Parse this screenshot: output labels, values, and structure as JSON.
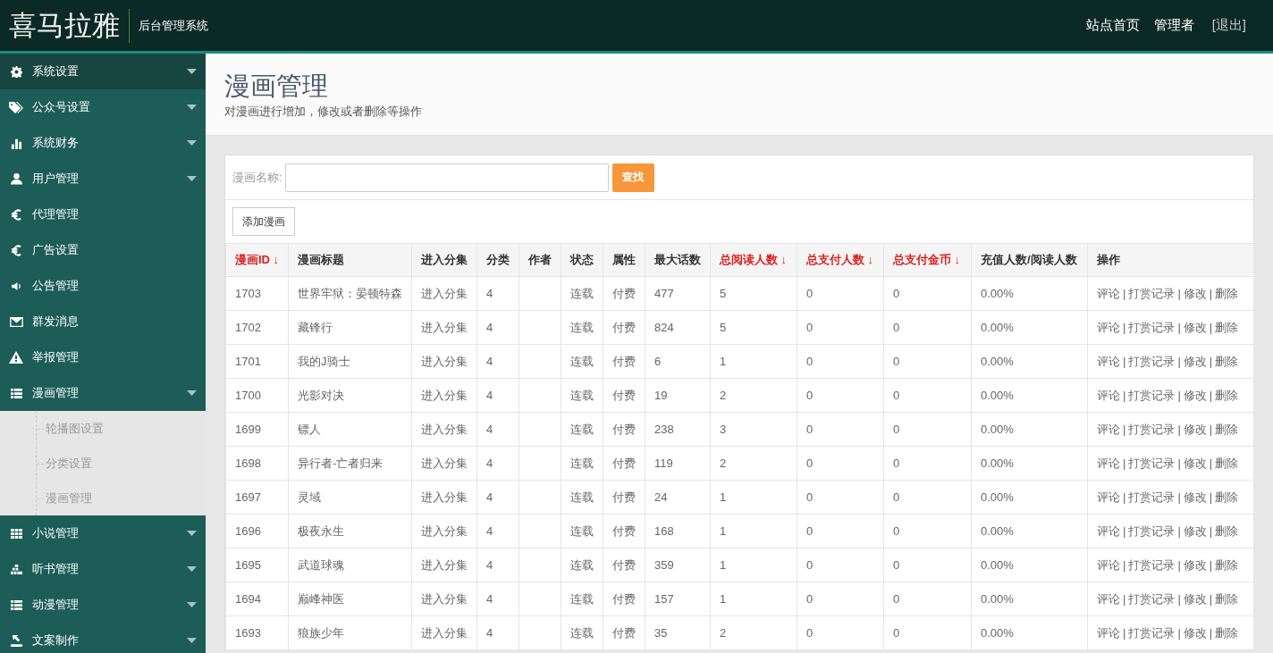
{
  "header": {
    "logo": "喜马拉雅",
    "subtitle": "后台管理系统",
    "links": [
      "站点首页",
      "管理者",
      "[退出]"
    ]
  },
  "sidebar": {
    "items": [
      {
        "label": "系统设置",
        "selected": true,
        "has_submenu": true
      },
      {
        "label": "公众号设置",
        "selected": false,
        "has_submenu": true
      },
      {
        "label": "系统财务",
        "selected": false,
        "has_submenu": true
      },
      {
        "label": "用户管理",
        "selected": false,
        "has_submenu": true
      },
      {
        "label": "代理管理",
        "selected": false,
        "has_submenu": false
      },
      {
        "label": "广告设置",
        "selected": false,
        "has_submenu": false
      },
      {
        "label": "公告管理",
        "selected": false,
        "has_submenu": false
      },
      {
        "label": "群发消息",
        "selected": false,
        "has_submenu": false
      },
      {
        "label": "举报管理",
        "selected": false,
        "has_submenu": false
      },
      {
        "label": "漫画管理",
        "selected": false,
        "has_submenu": true,
        "expanded": true,
        "children": [
          {
            "label": "轮播图设置"
          },
          {
            "label": "分类设置"
          },
          {
            "label": "漫画管理"
          }
        ]
      },
      {
        "label": "小说管理",
        "selected": false,
        "has_submenu": true
      },
      {
        "label": "听书管理",
        "selected": false,
        "has_submenu": true
      },
      {
        "label": "动漫管理",
        "selected": false,
        "has_submenu": true
      },
      {
        "label": "文案制作",
        "selected": false,
        "has_submenu": true
      }
    ]
  },
  "page": {
    "title": "漫画管理",
    "description": "对漫画进行增加，修改或者删除等操作"
  },
  "search": {
    "label": "漫画名称:",
    "button": "查找"
  },
  "add_button": "添加漫画",
  "table": {
    "action_separator": "|",
    "columns": [
      {
        "label": "漫画ID ↓",
        "sortable": true
      },
      {
        "label": "漫画标题",
        "sortable": false
      },
      {
        "label": "进入分集",
        "sortable": false
      },
      {
        "label": "分类",
        "sortable": false
      },
      {
        "label": "作者",
        "sortable": false
      },
      {
        "label": "状态",
        "sortable": false
      },
      {
        "label": "属性",
        "sortable": false
      },
      {
        "label": "最大话数",
        "sortable": false
      },
      {
        "label": "总阅读人数 ↓",
        "sortable": true
      },
      {
        "label": "总支付人数 ↓",
        "sortable": true
      },
      {
        "label": "总支付金币 ↓",
        "sortable": true
      },
      {
        "label": "充值人数/阅读人数",
        "sortable": false
      },
      {
        "label": "操作",
        "sortable": false
      }
    ],
    "rows": [
      {
        "id": "1703",
        "title": "世界牢狱：晏顿特森",
        "episodes": "进入分集",
        "category": "4",
        "status": "连载",
        "attribute": "付费",
        "max_chapters": "477",
        "readers": "5",
        "payers": "0",
        "coins": "0",
        "ratio": "0.00%",
        "actions": [
          "评论",
          "打赏记录",
          "修改",
          "删除"
        ]
      },
      {
        "id": "1702",
        "title": "藏锋行",
        "episodes": "进入分集",
        "category": "4",
        "status": "连载",
        "attribute": "付费",
        "max_chapters": "824",
        "readers": "5",
        "payers": "0",
        "coins": "0",
        "ratio": "0.00%",
        "actions": [
          "评论",
          "打赏记录",
          "修改",
          "删除"
        ]
      },
      {
        "id": "1701",
        "title": "我的J骑士",
        "episodes": "进入分集",
        "category": "4",
        "status": "连载",
        "attribute": "付费",
        "max_chapters": "6",
        "readers": "1",
        "payers": "0",
        "coins": "0",
        "ratio": "0.00%",
        "actions": [
          "评论",
          "打赏记录",
          "修改",
          "删除"
        ]
      },
      {
        "id": "1700",
        "title": "光影对决",
        "episodes": "进入分集",
        "category": "4",
        "status": "连载",
        "attribute": "付费",
        "max_chapters": "19",
        "readers": "2",
        "payers": "0",
        "coins": "0",
        "ratio": "0.00%",
        "actions": [
          "评论",
          "打赏记录",
          "修改",
          "删除"
        ]
      },
      {
        "id": "1699",
        "title": "镖人",
        "episodes": "进入分集",
        "category": "4",
        "status": "连载",
        "attribute": "付费",
        "max_chapters": "238",
        "readers": "3",
        "payers": "0",
        "coins": "0",
        "ratio": "0.00%",
        "actions": [
          "评论",
          "打赏记录",
          "修改",
          "删除"
        ]
      },
      {
        "id": "1698",
        "title": "异行者-亡者归来",
        "episodes": "进入分集",
        "category": "4",
        "status": "连载",
        "attribute": "付费",
        "max_chapters": "119",
        "readers": "2",
        "payers": "0",
        "coins": "0",
        "ratio": "0.00%",
        "actions": [
          "评论",
          "打赏记录",
          "修改",
          "删除"
        ]
      },
      {
        "id": "1697",
        "title": "灵域",
        "episodes": "进入分集",
        "category": "4",
        "status": "连载",
        "attribute": "付费",
        "max_chapters": "24",
        "readers": "1",
        "payers": "0",
        "coins": "0",
        "ratio": "0.00%",
        "actions": [
          "评论",
          "打赏记录",
          "修改",
          "删除"
        ]
      },
      {
        "id": "1696",
        "title": "极夜永生",
        "episodes": "进入分集",
        "category": "4",
        "status": "连载",
        "attribute": "付费",
        "max_chapters": "168",
        "readers": "1",
        "payers": "0",
        "coins": "0",
        "ratio": "0.00%",
        "actions": [
          "评论",
          "打赏记录",
          "修改",
          "删除"
        ]
      },
      {
        "id": "1695",
        "title": "武道球魂",
        "episodes": "进入分集",
        "category": "4",
        "status": "连载",
        "attribute": "付费",
        "max_chapters": "359",
        "readers": "1",
        "payers": "0",
        "coins": "0",
        "ratio": "0.00%",
        "actions": [
          "评论",
          "打赏记录",
          "修改",
          "删除"
        ]
      },
      {
        "id": "1694",
        "title": "巅峰神医",
        "episodes": "进入分集",
        "category": "4",
        "status": "连载",
        "attribute": "付费",
        "max_chapters": "157",
        "readers": "1",
        "payers": "0",
        "coins": "0",
        "ratio": "0.00%",
        "actions": [
          "评论",
          "打赏记录",
          "修改",
          "删除"
        ]
      },
      {
        "id": "1693",
        "title": "狼族少年",
        "episodes": "进入分集",
        "category": "4",
        "status": "连载",
        "attribute": "付费",
        "max_chapters": "35",
        "readers": "2",
        "payers": "0",
        "coins": "0",
        "ratio": "0.00%",
        "actions": [
          "评论",
          "打赏记录",
          "修改",
          "删除"
        ]
      }
    ]
  }
}
